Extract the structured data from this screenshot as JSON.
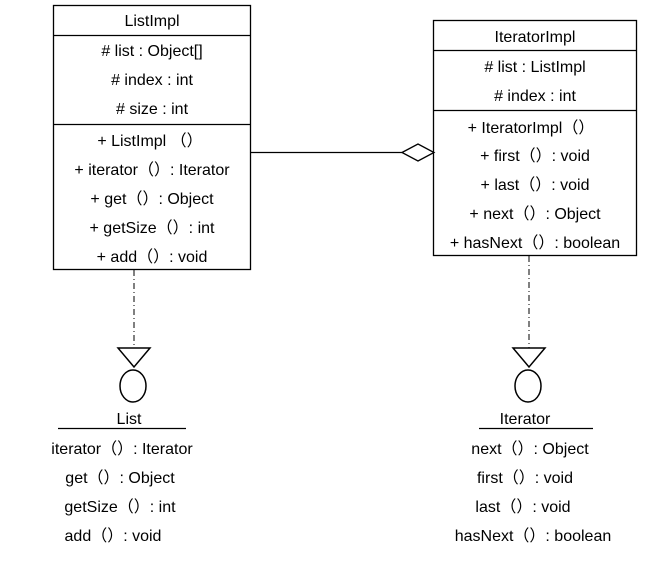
{
  "listImpl": {
    "name": "ListImpl",
    "attributes": [
      "# list : Object[]",
      "# index : int",
      "# size : int"
    ],
    "methods": [
      "+ ListImpl （）",
      "+ iterator（）: Iterator",
      "+ get（）: Object",
      "+ getSize（）: int",
      "+ add（）: void"
    ]
  },
  "iteratorImpl": {
    "name": "IteratorImpl",
    "attributes": [
      "# list : ListImpl",
      "# index : int"
    ],
    "methods": [
      "+ IteratorImpl（）",
      "+ first（）: void",
      "+ last（）: void",
      "+ next（）: Object",
      "+ hasNext（）: boolean"
    ]
  },
  "listInterface": {
    "name": "List",
    "methods": [
      "iterator（）: Iterator",
      "get（）: Object",
      "getSize（）: int",
      "add（）: void"
    ]
  },
  "iteratorInterface": {
    "name": "Iterator",
    "methods": [
      "next（）: Object",
      "first（）: void",
      "last（）: void",
      "hasNext（）: boolean"
    ]
  }
}
